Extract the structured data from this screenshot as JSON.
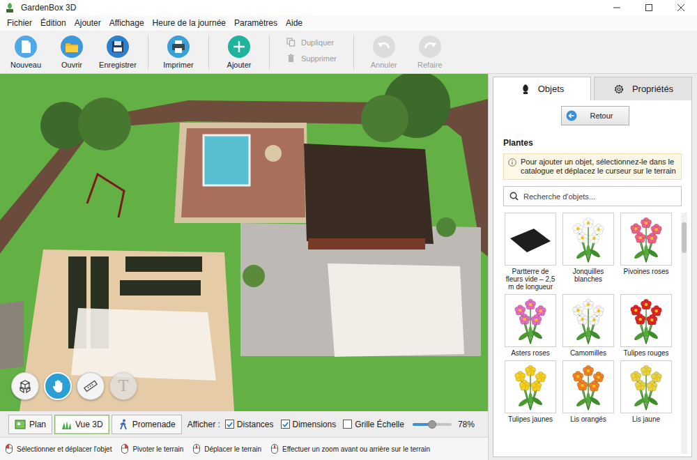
{
  "window": {
    "title": "GardenBox 3D"
  },
  "menu": [
    "Fichier",
    "Édition",
    "Ajouter",
    "Affichage",
    "Heure de la journée",
    "Paramètres",
    "Aide"
  ],
  "toolbar": [
    [
      {
        "label": "Nouveau",
        "kind": "new",
        "disabled": false
      },
      {
        "label": "Ouvrir",
        "kind": "open",
        "disabled": false
      },
      {
        "label": "Enregistrer",
        "kind": "save",
        "disabled": false
      }
    ],
    [
      {
        "label": "Imprimer",
        "kind": "print",
        "disabled": false
      }
    ],
    [
      {
        "label": "Ajouter",
        "kind": "add",
        "disabled": false
      }
    ],
    [
      {
        "label": "Dupliquer",
        "kind": "duplicate",
        "disabled": true
      },
      {
        "label": "Supprimer",
        "kind": "delete",
        "disabled": true
      }
    ],
    [
      {
        "label": "Annuler",
        "kind": "undo",
        "disabled": true
      },
      {
        "label": "Refaire",
        "kind": "redo",
        "disabled": true
      }
    ]
  ],
  "view_tools": [
    {
      "kind": "objects",
      "selected": false,
      "disabled": false
    },
    {
      "kind": "hand",
      "selected": true,
      "disabled": false
    },
    {
      "kind": "ruler",
      "selected": false,
      "disabled": false
    },
    {
      "kind": "text",
      "glyph": "T",
      "selected": false,
      "disabled": true
    }
  ],
  "view_modes": [
    {
      "label": "Plan",
      "kind": "plan",
      "selected": false
    },
    {
      "label": "Vue 3D",
      "kind": "3d",
      "selected": true
    },
    {
      "label": "Promenade",
      "kind": "walk",
      "selected": false
    }
  ],
  "display": {
    "label": "Afficher :",
    "options": [
      {
        "label": "Distances",
        "checked": true
      },
      {
        "label": "Dimensions",
        "checked": true
      },
      {
        "label": "Grille Échelle",
        "checked": false
      }
    ],
    "zoom": {
      "level": 0.5,
      "reading": "78%"
    }
  },
  "status_bar": [
    {
      "text": "Sélectionner et déplacer l'objet",
      "kind": "left"
    },
    {
      "text": "Pivoter le terrain",
      "kind": "right"
    },
    {
      "text": "Déplacer le terrain",
      "kind": "middle"
    },
    {
      "text": "Effectuer un zoom avant ou arrière sur le terrain",
      "kind": "wheel"
    }
  ],
  "panel": {
    "tabs": [
      {
        "label": "Objets",
        "kind": "objects",
        "selected": true
      },
      {
        "label": "Propriétés",
        "kind": "properties",
        "selected": false
      }
    ],
    "back": "Retour",
    "category": "Plantes",
    "info": "Pour ajouter un objet, sélectionnez-le dans le catalogue et déplacez le curseur sur le terrain",
    "search": {
      "placeholder": "Recherche d'objets..."
    },
    "items": [
      {
        "label": "Partterre de fleurs vide – 2,5 m de longueur",
        "kind": "bed",
        "color": "#1e1e1e"
      },
      {
        "label": "Jonquilles blanches",
        "kind": "flower",
        "color": "#ffffff"
      },
      {
        "label": "Pivoines roses",
        "kind": "flower",
        "color": "#f0608c"
      },
      {
        "label": "Asters roses",
        "kind": "flower",
        "color": "#e46ec4"
      },
      {
        "label": "Camomilles",
        "kind": "flower",
        "color": "#f8f8f8"
      },
      {
        "label": "Tulipes rouges",
        "kind": "flower",
        "color": "#e02424"
      },
      {
        "label": "Tulipes jaunes",
        "kind": "flower",
        "color": "#f4d020"
      },
      {
        "label": "Lis orangés",
        "kind": "flower",
        "color": "#f08224"
      },
      {
        "label": "Lis jaune",
        "kind": "flower",
        "color": "#e8d448"
      }
    ]
  }
}
